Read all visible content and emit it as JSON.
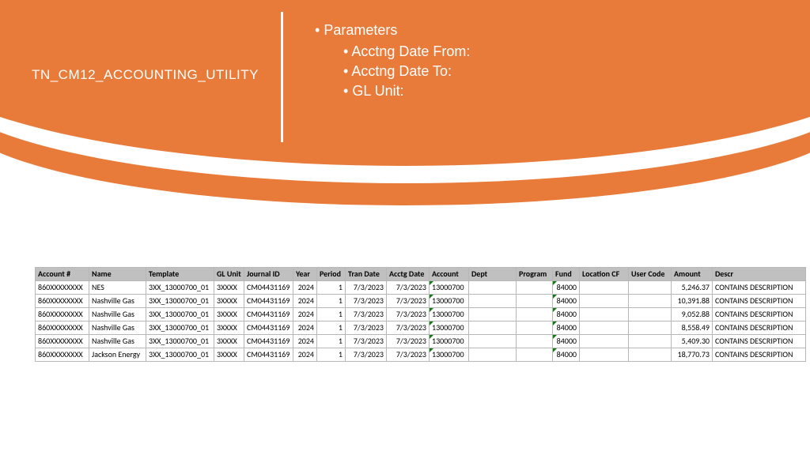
{
  "header": {
    "title": "TN_CM12_ACCOUNTING_UTILITY",
    "params_label": "Parameters",
    "params": {
      "p0": "Acctng Date From:",
      "p1": "Acctng Date To:",
      "p2": "GL Unit:"
    }
  },
  "table": {
    "headers": {
      "h0": "Account #",
      "h1": "Name",
      "h2": "Template",
      "h3": "GL Unit",
      "h4": "Journal ID",
      "h5": "Year",
      "h6": "Period",
      "h7": "Tran Date",
      "h8": "Acctg Date",
      "h9": "Account",
      "h10": "Dept",
      "h11": "Program",
      "h12": "Fund",
      "h13": "Location CF",
      "h14": "User Code",
      "h15": "Amount",
      "h16": "Descr"
    },
    "rows": [
      {
        "account_no": "860XXXXXXXX",
        "name": "NES",
        "template": "3XX_13000700_01",
        "gl_unit": "3XXXX",
        "journal_id": "CM04431169",
        "year": "2024",
        "period": "1",
        "tran_date": "7/3/2023",
        "acctg_date": "7/3/2023",
        "account": "13000700",
        "dept": "",
        "program": "",
        "fund": "84000",
        "location_cf": "",
        "user_code": "",
        "amount": "5,246.37",
        "descr": "CONTAINS DESCRIPTION"
      },
      {
        "account_no": "860XXXXXXXX",
        "name": "Nashville Gas",
        "template": "3XX_13000700_01",
        "gl_unit": "3XXXX",
        "journal_id": "CM04431169",
        "year": "2024",
        "period": "1",
        "tran_date": "7/3/2023",
        "acctg_date": "7/3/2023",
        "account": "13000700",
        "dept": "",
        "program": "",
        "fund": "84000",
        "location_cf": "",
        "user_code": "",
        "amount": "10,391.88",
        "descr": "CONTAINS DESCRIPTION"
      },
      {
        "account_no": "860XXXXXXXX",
        "name": "Nashville Gas",
        "template": "3XX_13000700_01",
        "gl_unit": "3XXXX",
        "journal_id": "CM04431169",
        "year": "2024",
        "period": "1",
        "tran_date": "7/3/2023",
        "acctg_date": "7/3/2023",
        "account": "13000700",
        "dept": "",
        "program": "",
        "fund": "84000",
        "location_cf": "",
        "user_code": "",
        "amount": "9,052.88",
        "descr": "CONTAINS DESCRIPTION"
      },
      {
        "account_no": "860XXXXXXXX",
        "name": "Nashville Gas",
        "template": "3XX_13000700_01",
        "gl_unit": "3XXXX",
        "journal_id": "CM04431169",
        "year": "2024",
        "period": "1",
        "tran_date": "7/3/2023",
        "acctg_date": "7/3/2023",
        "account": "13000700",
        "dept": "",
        "program": "",
        "fund": "84000",
        "location_cf": "",
        "user_code": "",
        "amount": "8,558.49",
        "descr": "CONTAINS DESCRIPTION"
      },
      {
        "account_no": "860XXXXXXXX",
        "name": "Nashville Gas",
        "template": "3XX_13000700_01",
        "gl_unit": "3XXXX",
        "journal_id": "CM04431169",
        "year": "2024",
        "period": "1",
        "tran_date": "7/3/2023",
        "acctg_date": "7/3/2023",
        "account": "13000700",
        "dept": "",
        "program": "",
        "fund": "84000",
        "location_cf": "",
        "user_code": "",
        "amount": "5,409.30",
        "descr": "CONTAINS DESCRIPTION"
      },
      {
        "account_no": "860XXXXXXXX",
        "name": "Jackson Energy",
        "template": "3XX_13000700_01",
        "gl_unit": "3XXXX",
        "journal_id": "CM04431169",
        "year": "2024",
        "period": "1",
        "tran_date": "7/3/2023",
        "acctg_date": "7/3/2023",
        "account": "13000700",
        "dept": "",
        "program": "",
        "fund": "84000",
        "location_cf": "",
        "user_code": "",
        "amount": "18,770.73",
        "descr": "CONTAINS DESCRIPTION"
      }
    ]
  }
}
